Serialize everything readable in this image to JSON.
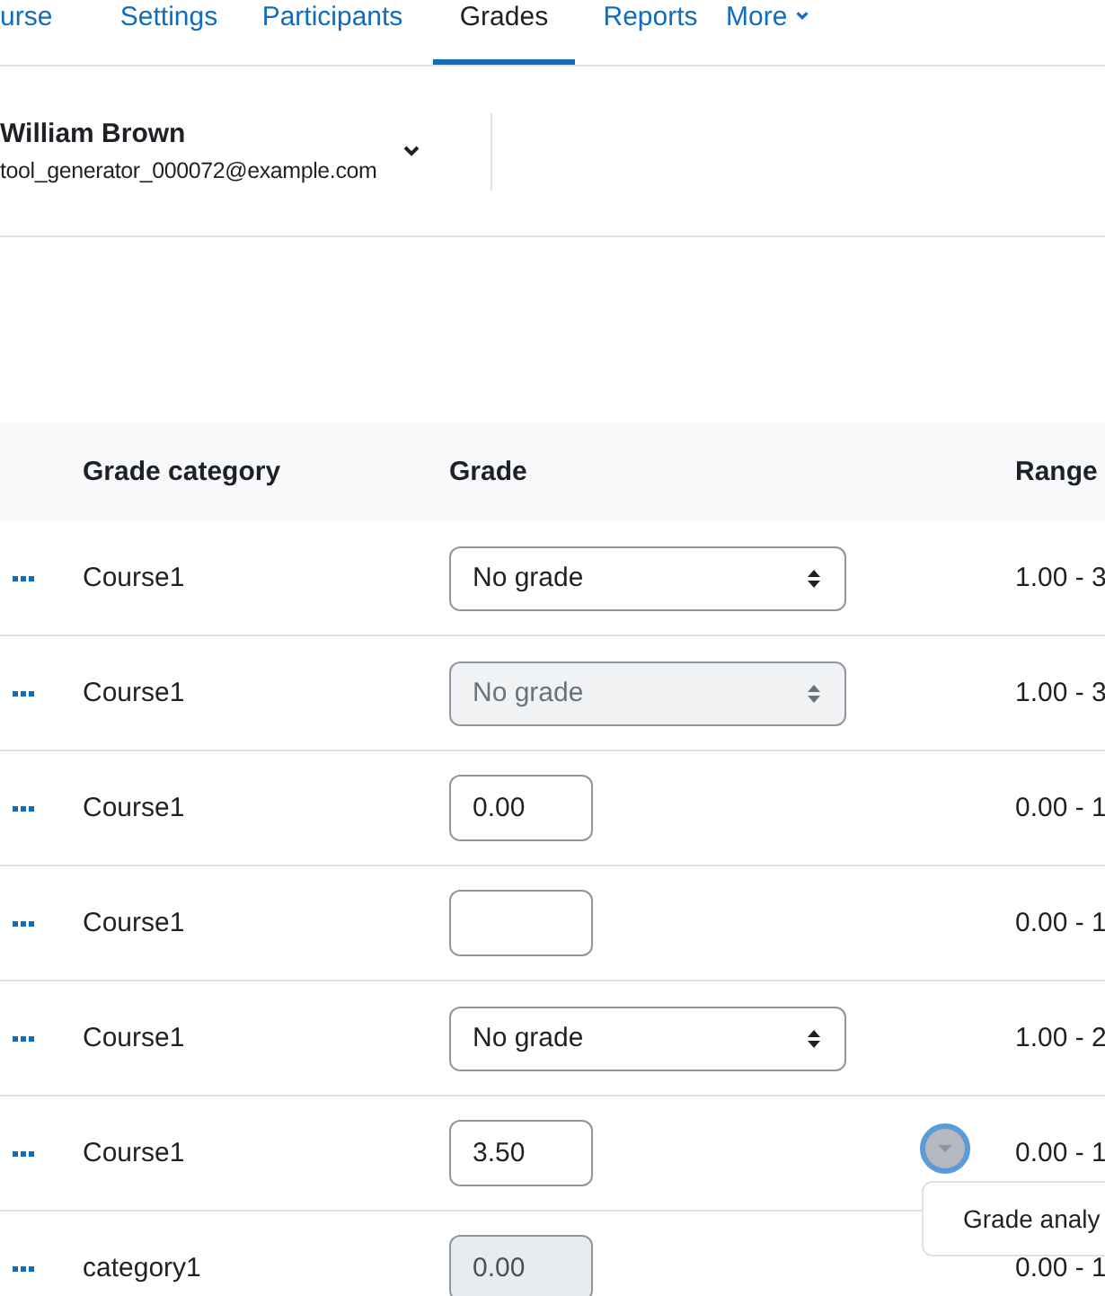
{
  "tabs": [
    {
      "label": "urse",
      "selected": false
    },
    {
      "label": "Settings",
      "selected": false
    },
    {
      "label": "Participants",
      "selected": false
    },
    {
      "label": "Grades",
      "selected": true
    },
    {
      "label": "Reports",
      "selected": false
    },
    {
      "label": "More",
      "selected": false,
      "dropdown": true
    }
  ],
  "user": {
    "name": "William Brown",
    "email": "tool_generator_000072@example.com"
  },
  "table": {
    "columns": [
      "Grade category",
      "Grade",
      "Range"
    ],
    "rows": [
      {
        "category": "Course1",
        "grade": {
          "kind": "select",
          "value": "No grade",
          "disabled": false
        },
        "range": "1.00 - 3"
      },
      {
        "category": "Course1",
        "grade": {
          "kind": "select",
          "value": "No grade",
          "disabled": true
        },
        "range": "1.00 - 3"
      },
      {
        "category": "Course1",
        "grade": {
          "kind": "input",
          "value": "0.00",
          "disabled": false
        },
        "range": "0.00 - 1"
      },
      {
        "category": "Course1",
        "grade": {
          "kind": "input",
          "disabled": false
        },
        "range": "0.00 - 1"
      },
      {
        "category": "Course1",
        "grade": {
          "kind": "select",
          "value": "No grade",
          "disabled": false
        },
        "range": "1.00 - 2"
      },
      {
        "category": "Course1",
        "grade": {
          "kind": "input",
          "value": "3.50",
          "disabled": false
        },
        "range": "0.00 - 1",
        "menu": {
          "item": "Grade analy"
        }
      },
      {
        "category": "category1",
        "grade": {
          "kind": "input",
          "value": "0.00",
          "disabled": true
        },
        "range": "0.00 - 1"
      }
    ]
  }
}
